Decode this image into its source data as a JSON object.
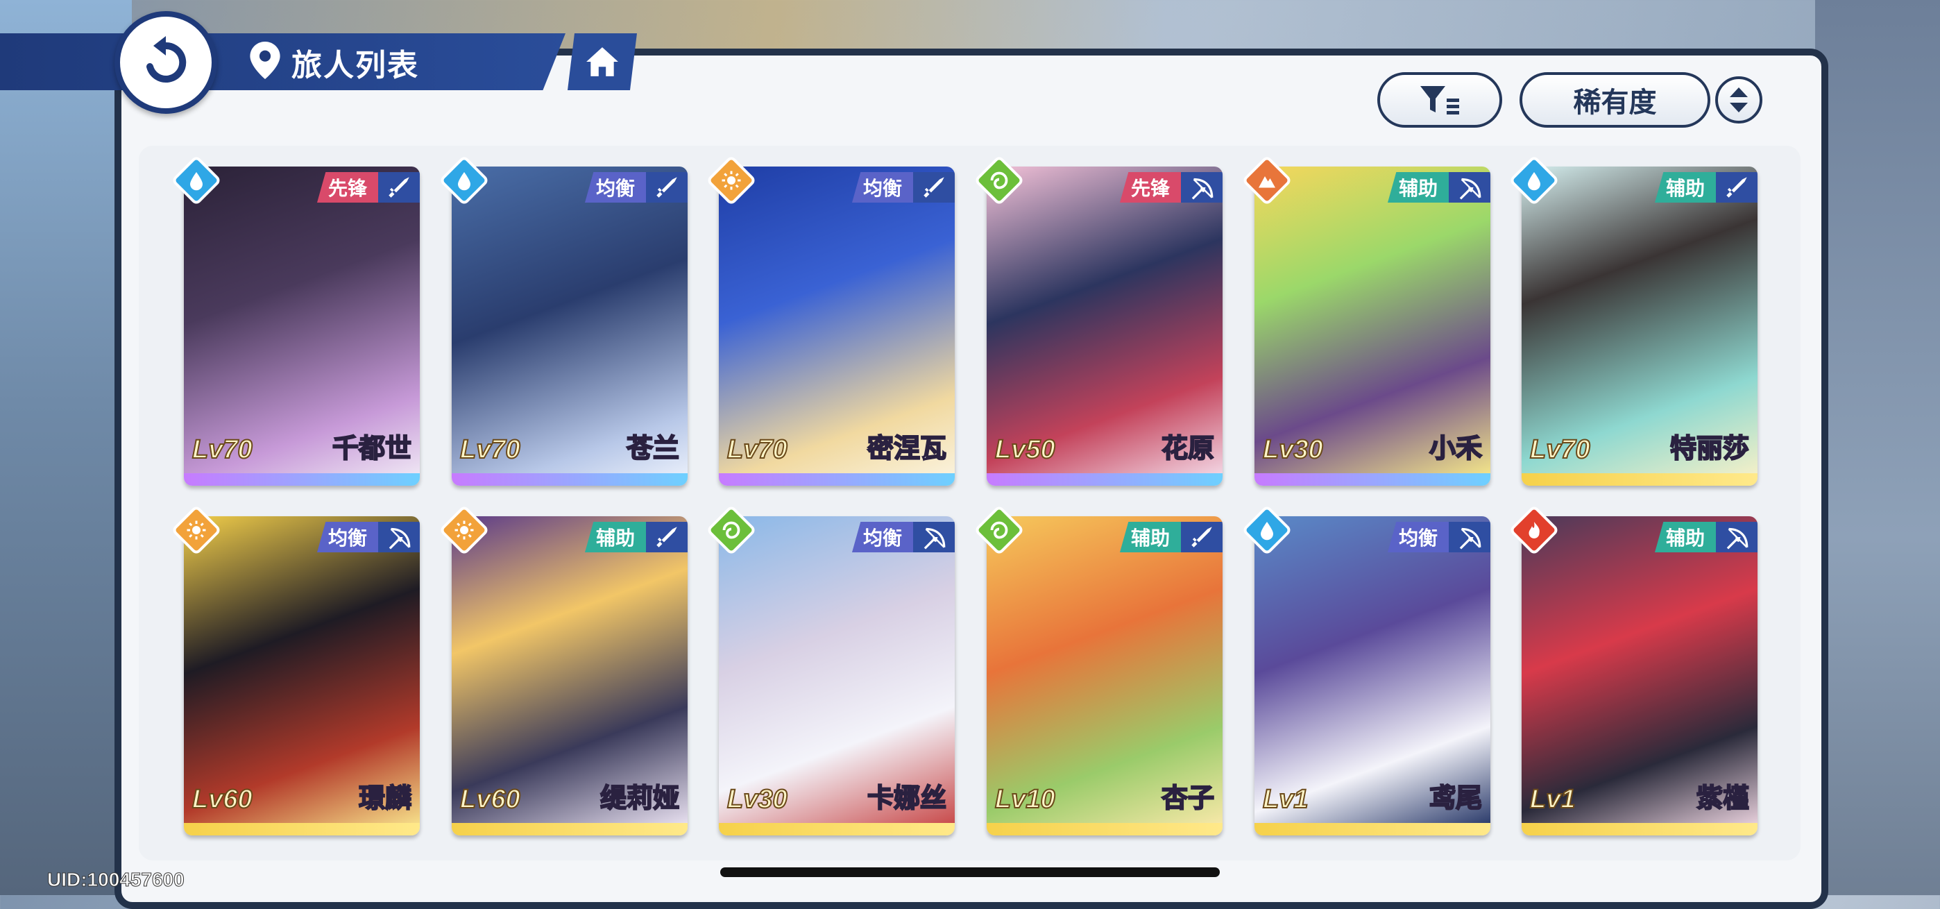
{
  "header": {
    "title": "旅人列表"
  },
  "toolbar": {
    "sort_label": "稀有度"
  },
  "uid": "UID:100457600",
  "colors": {
    "accent": "#1f3a7a",
    "water": "#2fa7e6",
    "light": "#f2a23a",
    "wind": "#6cbf3a",
    "earth": "#e8753a",
    "fire": "#e2402c"
  },
  "cards": [
    {
      "level": "Lv70",
      "name": "千都世",
      "role": "先锋",
      "element": "water",
      "weapon": "sword"
    },
    {
      "level": "Lv70",
      "name": "苍兰",
      "role": "均衡",
      "element": "water",
      "weapon": "sword"
    },
    {
      "level": "Lv70",
      "name": "密涅瓦",
      "role": "均衡",
      "element": "light",
      "weapon": "sword"
    },
    {
      "level": "Lv50",
      "name": "花原",
      "role": "先锋",
      "element": "wind",
      "weapon": "bow"
    },
    {
      "level": "Lv30",
      "name": "小禾",
      "role": "辅助",
      "element": "earth",
      "weapon": "bow"
    },
    {
      "level": "Lv70",
      "name": "特丽莎",
      "role": "辅助",
      "element": "water",
      "weapon": "sword"
    },
    {
      "level": "Lv60",
      "name": "璟麟",
      "role": "均衡",
      "element": "light",
      "weapon": "bow"
    },
    {
      "level": "Lv60",
      "name": "缇莉娅",
      "role": "辅助",
      "element": "light",
      "weapon": "sword"
    },
    {
      "level": "Lv30",
      "name": "卡娜丝",
      "role": "均衡",
      "element": "wind",
      "weapon": "bow"
    },
    {
      "level": "Lv10",
      "name": "杏子",
      "role": "辅助",
      "element": "wind",
      "weapon": "sword"
    },
    {
      "level": "Lv1",
      "name": "鸢尾",
      "role": "均衡",
      "element": "water",
      "weapon": "bow"
    },
    {
      "level": "Lv1",
      "name": "紫槿",
      "role": "辅助",
      "element": "fire",
      "weapon": "bow"
    }
  ]
}
